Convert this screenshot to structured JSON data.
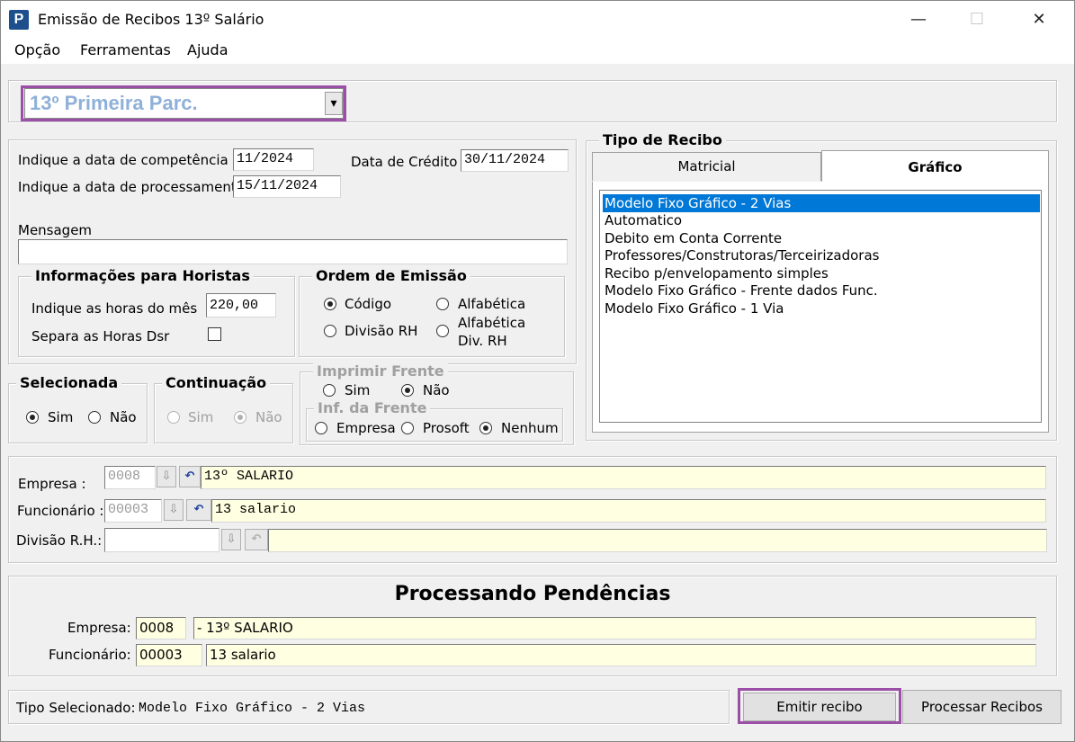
{
  "window": {
    "title": "Emissão de Recibos 13º Salário",
    "app_icon_letter": "P",
    "minimize": "—",
    "maximize": "☐",
    "close": "✕"
  },
  "menu": [
    "Opção",
    "Ferramentas",
    "Ajuda"
  ],
  "parcel_select": {
    "value": "13º Primeira Parc.",
    "arrow": "▾"
  },
  "dates": {
    "competencia_label": "Indique a data de competência",
    "competencia_value": "11/2024",
    "processamento_label": "Indique a data de processamento",
    "processamento_value": "15/11/2024",
    "credito_label": "Data de Crédito",
    "credito_value": "30/11/2024"
  },
  "mensagem": {
    "label": "Mensagem",
    "value": ""
  },
  "horistas": {
    "title": "Informações para Horistas",
    "horas_label": "Indique as horas do mês",
    "horas_value": "220,00",
    "separa_label": "Separa as Horas Dsr"
  },
  "ordem": {
    "title": "Ordem de Emissão",
    "codigo": "Código",
    "alfabetica": "Alfabética",
    "divisao": "Divisão RH",
    "alfabetica_div_1": "Alfabética",
    "alfabetica_div_2": "Div.  RH"
  },
  "selecionada": {
    "title": "Selecionada",
    "sim": "Sim",
    "nao": "Não"
  },
  "continuacao": {
    "title": "Continuação",
    "sim": "Sim",
    "nao": "Não"
  },
  "imprimir_frente": {
    "title": "Imprimir Frente",
    "sim": "Sim",
    "nao": "Não",
    "inf_title": "Inf. da Frente",
    "empresa": "Empresa",
    "prosoft": "Prosoft",
    "nenhum": "Nenhum"
  },
  "tipo_recibo": {
    "title": "Tipo de Recibo",
    "tab_matricial": "Matricial",
    "tab_grafico": "Gráfico",
    "items": [
      "Modelo Fixo Gráfico - 2 Vias",
      "Automatico",
      "Debito em Conta Corrente",
      "Professores/Construtoras/Terceirizadoras",
      "Recibo p/envelopamento simples",
      "Modelo Fixo Gráfico - Frente dados Func.",
      "Modelo Fixo Gráfico - 1 Via"
    ]
  },
  "selecao": {
    "empresa_label": "Empresa :",
    "empresa_code": "0008",
    "empresa_name": "13º SALARIO",
    "funcionario_label": "Funcionário :",
    "funcionario_code": "00003",
    "funcionario_name": "13 salario",
    "divisao_label": "Divisão R.H.:",
    "divisao_code": "",
    "divisao_name": "",
    "lookup_icon": "⇩",
    "undo_icon": "↶"
  },
  "pendencias": {
    "title": "Processando Pendências",
    "empresa_label": "Empresa:",
    "empresa_code": "0008",
    "empresa_name": "- 13º SALARIO",
    "funcionario_label": "Funcionário:",
    "funcionario_code": "00003",
    "funcionario_name": "13 salario"
  },
  "status": {
    "label": "Tipo Selecionado:",
    "value": "Modelo Fixo Gráfico - 2 Vias"
  },
  "buttons": {
    "emitir": "Emitir recibo",
    "processar": "Processar Recibos"
  },
  "colors": {
    "highlight": "#9b4fa7",
    "selection": "#0078d7",
    "parcel_text": "#8fb0d8",
    "field_yellow": "#ffffe1"
  }
}
